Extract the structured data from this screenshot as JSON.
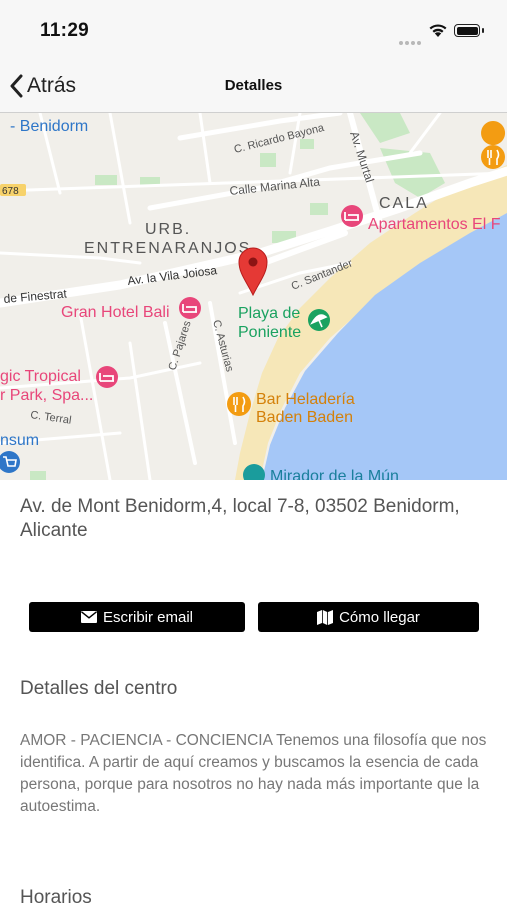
{
  "status_bar": {
    "time": "11:29"
  },
  "nav": {
    "back_label": "Atrás",
    "title": "Detalles"
  },
  "map": {
    "labels": {
      "benidorm": "- Benidorm",
      "ricardo_bayona": "C. Ricardo Bayona",
      "av_murtal": "Av. Murtal",
      "road_678": "678",
      "calle_marina_alta": "Calle Marina Alta",
      "cala": "CALA",
      "urb": "URB.",
      "entrenaranjos": "ENTRENARANJOS",
      "apartamentos": "Apartamentos El F",
      "vila_joiosa": "Av. la Vila Joiosa",
      "santander": "C. Santander",
      "finestrat": "de Finestrat",
      "gran_hotel_bali": "Gran Hotel Bali",
      "playa_line1": "Playa de",
      "playa_line2": "Poniente",
      "asturias": "C. Asturias",
      "magic_line1": "gic Tropical",
      "magic_line2": "r Park, Spa...",
      "pajares": "C. Pajares",
      "bar_line1": "Bar Heladería",
      "bar_line2": "Baden Baden",
      "terral": "C. Terral",
      "nsum": "nsum",
      "mirador": "Mirador de la Mún"
    },
    "colors": {
      "sea": "#a5c7f7",
      "beach": "#f6e7b8",
      "park": "#c9e8c4",
      "pin": "#e53935",
      "hotel": "#e8467a",
      "food": "#f39c12",
      "beach_icon": "#1aa260"
    }
  },
  "address": "Av. de Mont Benidorm,4, local 7-8, 03502 Benidorm, Alicante",
  "buttons": {
    "email": "Escribir email",
    "directions": "Cómo llegar"
  },
  "details": {
    "title": "Detalles del centro",
    "text": "AMOR - PACIENCIA - CONCIENCIA    Tenemos una filosofía que nos identifica. A partir de aquí creamos y buscamos la esencia de cada persona, porque para nosotros no hay nada más importante que la autoestima."
  },
  "schedule": {
    "title": "Horarios"
  }
}
